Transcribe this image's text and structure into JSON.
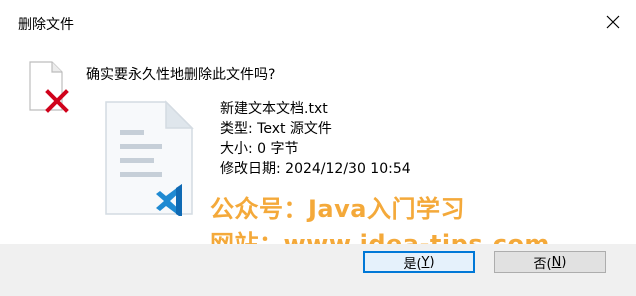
{
  "window": {
    "title": "删除文件",
    "close_icon": "close-icon"
  },
  "dialog": {
    "question": "确实要永久性地删除此文件吗?"
  },
  "file": {
    "name": "新建文本文档.txt",
    "type": "类型: Text 源文件",
    "size": "大小: 0 字节",
    "modified": "修改日期: 2024/12/30 10:54",
    "icon": "text-file-vscode-icon"
  },
  "watermark": {
    "line1": "公众号：Java入门学习",
    "line2": "网站：www.idea-tips.com"
  },
  "buttons": {
    "yes_label": "是(",
    "yes_key": "Y",
    "yes_suffix": ")",
    "no_label": "否(",
    "no_key": "N",
    "no_suffix": ")"
  },
  "colors": {
    "watermark": "#f4a93a",
    "delete_x": "#d0021b",
    "vscode_blue": "#1f8ad2",
    "focus_border": "#0078d7"
  }
}
